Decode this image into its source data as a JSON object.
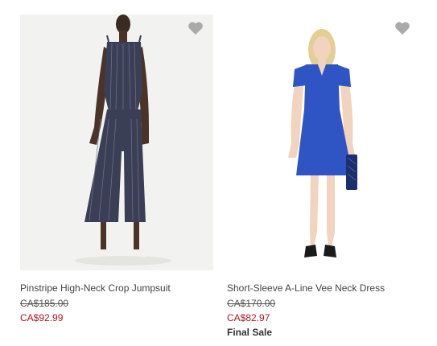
{
  "products": [
    {
      "title": "Pinstripe High-Neck Crop Jumpsuit",
      "original_price": "CA$185.00",
      "sale_price": "CA$92.99",
      "badge": "",
      "image_alt": "model wearing navy pinstripe jumpsuit",
      "favorite_icon": "heart-icon"
    },
    {
      "title": "Short-Sleeve A-Line Vee Neck Dress",
      "original_price": "CA$170.00",
      "sale_price": "CA$82.97",
      "badge": "Final Sale",
      "image_alt": "model wearing blue a-line dress",
      "favorite_icon": "heart-icon"
    }
  ],
  "colors": {
    "sale_price": "#b0161e",
    "favorite_icon": "#aaaaaa",
    "jumpsuit": "#3a3f55",
    "dress": "#2f55c4"
  }
}
